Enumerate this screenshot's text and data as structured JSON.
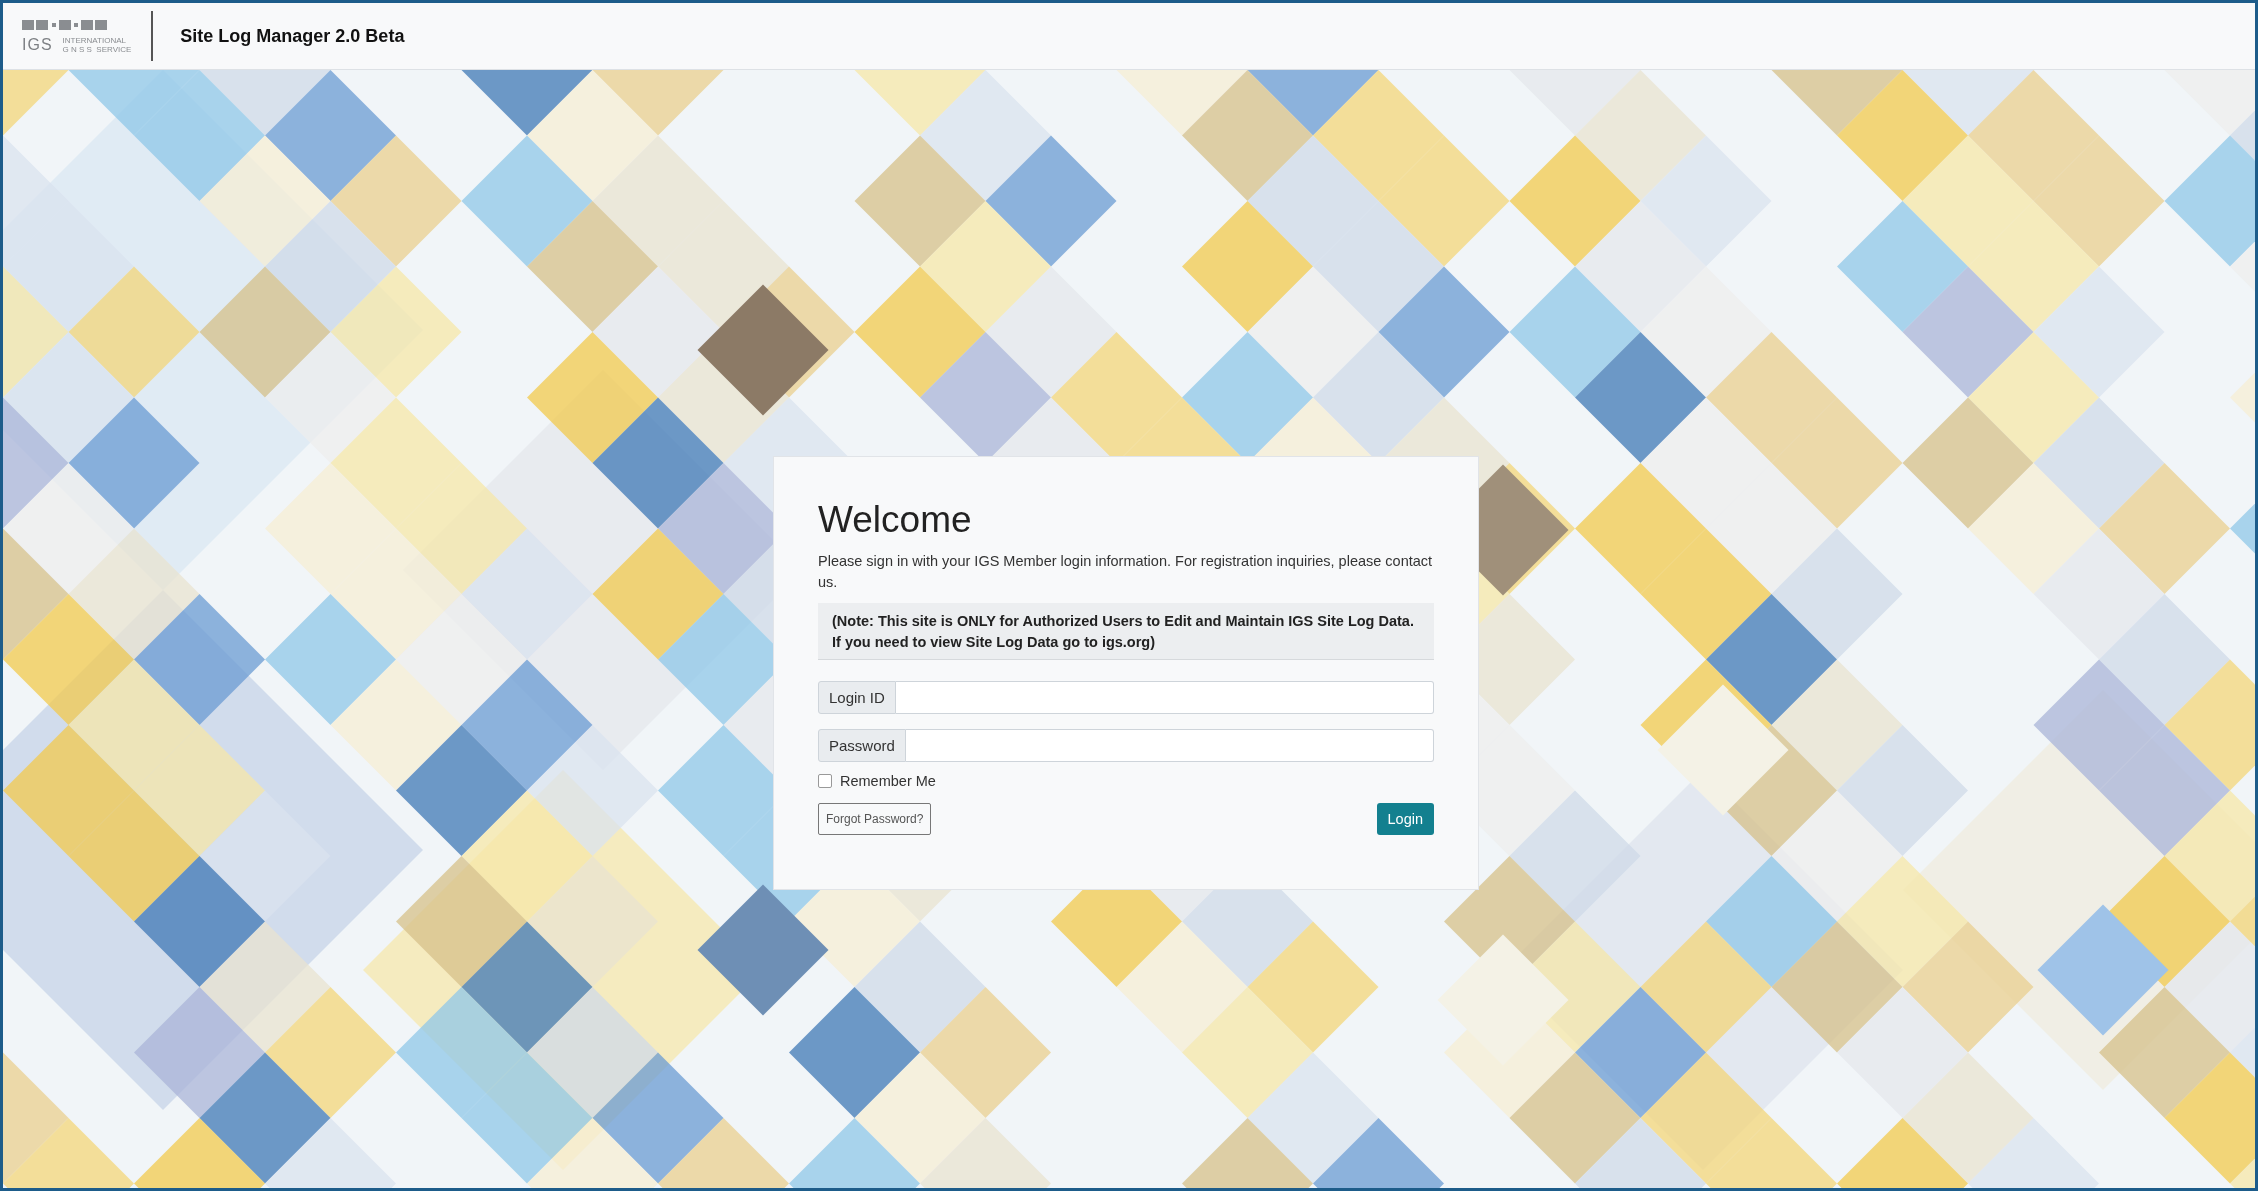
{
  "header": {
    "logo": {
      "abbr": "IGS",
      "line1": "INTERNATIONAL",
      "line2": "G N S S  SERVICE"
    },
    "title": "Site Log Manager 2.0 Beta"
  },
  "login": {
    "heading": "Welcome",
    "intro": "Please sign in with your IGS Member login information. For registration inquiries, please contact us.",
    "note": "(Note: This site is ONLY for Authorized Users to Edit and Maintain IGS Site Log Data. If you need to view Site Log Data go to igs.org)",
    "fields": [
      {
        "label": "Login ID"
      },
      {
        "label": "Password"
      }
    ],
    "remember": {
      "label": "Remember Me",
      "checked": false
    },
    "forgot_button": "Forgot Password?",
    "login_button": "Login"
  }
}
